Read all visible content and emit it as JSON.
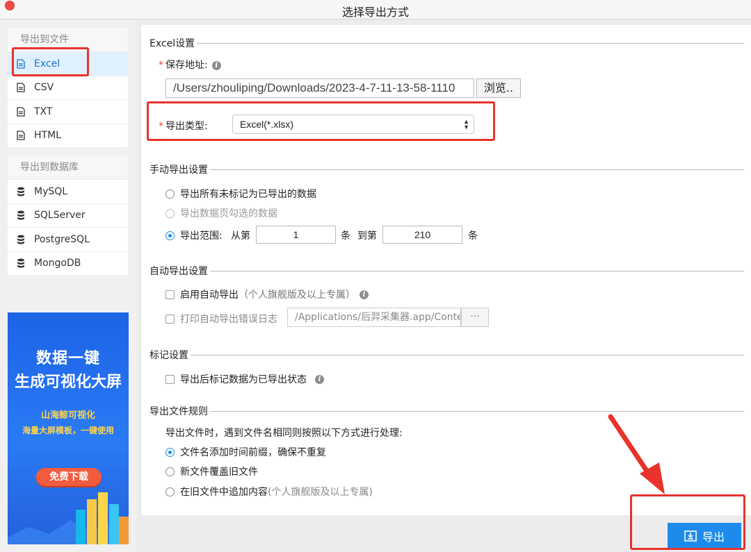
{
  "window": {
    "title": "选择导出方式"
  },
  "sidebar": {
    "file_group": {
      "header": "导出到文件",
      "items": [
        {
          "label": "Excel",
          "icon": "file-icon",
          "active": true
        },
        {
          "label": "CSV",
          "icon": "file-icon"
        },
        {
          "label": "TXT",
          "icon": "file-icon"
        },
        {
          "label": "HTML",
          "icon": "file-icon"
        }
      ]
    },
    "db_group": {
      "header": "导出到数据库",
      "items": [
        {
          "label": "MySQL",
          "icon": "database-icon"
        },
        {
          "label": "SQLServer",
          "icon": "database-icon"
        },
        {
          "label": "PostgreSQL",
          "icon": "database-icon"
        },
        {
          "label": "MongoDB",
          "icon": "database-icon"
        }
      ]
    },
    "ad": {
      "line1": "数据一键",
      "line2": "生成可视化大屏",
      "line3": "山海鲸可视化",
      "line4": "海量大屏模板，一键使用",
      "button": "免费下载"
    }
  },
  "excel_settings": {
    "title": "Excel设置",
    "save_path_label": "保存地址:",
    "save_path_value": "/Users/zhouliping/Downloads/2023-4-7-11-13-58-1110",
    "browse_label": "浏览..",
    "export_type_label": "导出类型:",
    "export_type_value": "Excel(*.xlsx)"
  },
  "manual_export": {
    "title": "手动导出设置",
    "option_unexported": "导出所有未标记为已导出的数据",
    "option_page_selected": "导出数据页勾选的数据",
    "option_range": "导出范围:",
    "from_label": "从第",
    "from_value": "1",
    "unit1": "条",
    "to_label": "到第",
    "to_value": "210",
    "unit2": "条"
  },
  "auto_export": {
    "title": "自动导出设置",
    "enable_label": "启用自动导出",
    "enable_note": "（个人旗舰版及以上专属）",
    "log_label": "打印自动导出错误日志",
    "log_path": "/Applications/后羿采集器.app/Conte",
    "log_btn": "···"
  },
  "mark_settings": {
    "title": "标记设置",
    "mark_label": "导出后标记数据为已导出状态"
  },
  "file_rules": {
    "title": "导出文件规则",
    "description": "导出文件时，遇到文件名相同则按照以下方式进行处理:",
    "option_prefix": "文件名添加时间前缀，确保不重复",
    "option_overwrite": "新文件覆盖旧文件",
    "option_append": "在旧文件中追加内容",
    "append_note": "(个人旗舰版及以上专属)"
  },
  "footer": {
    "export_label": "导出"
  },
  "colors": {
    "accent": "#1c8bec",
    "annotation": "#e8322b",
    "required": "#e5413a"
  }
}
